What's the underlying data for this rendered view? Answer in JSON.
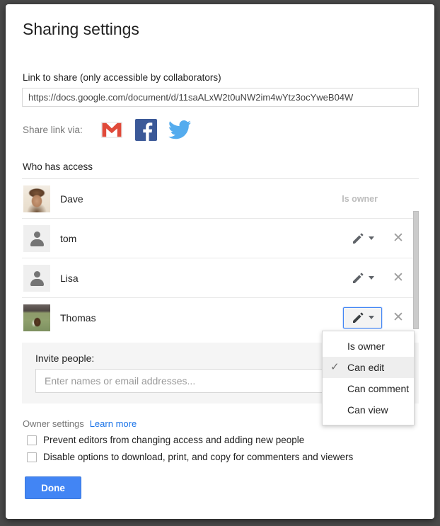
{
  "dialog": {
    "title": "Sharing settings"
  },
  "link_section": {
    "label": "Link to share (only accessible by collaborators)",
    "url": "https://docs.google.com/document/d/11saALxW2t0uNW2im4wYtz3ocYweB04W",
    "share_via_label": "Share link via:",
    "social": [
      {
        "name": "gmail-icon",
        "label": "Gmail",
        "color": "#d93025"
      },
      {
        "name": "facebook-icon",
        "label": "Facebook",
        "color": "#3b5998"
      },
      {
        "name": "twitter-icon",
        "label": "Twitter",
        "color": "#55acee"
      }
    ]
  },
  "access_section": {
    "heading": "Who has access",
    "rows": [
      {
        "name": "Dave",
        "avatar": "photo-person",
        "status": "Is owner",
        "has_controls": false
      },
      {
        "name": "tom",
        "avatar": "silhouette",
        "status": "",
        "has_controls": true
      },
      {
        "name": "Lisa",
        "avatar": "silhouette",
        "status": "",
        "has_controls": true
      },
      {
        "name": "Thomas",
        "avatar": "photo-dog",
        "status": "",
        "has_controls": true,
        "active": true
      }
    ]
  },
  "permission_menu": {
    "open": true,
    "items": [
      {
        "label": "Is owner",
        "checked": false
      },
      {
        "label": "Can edit",
        "checked": true
      },
      {
        "label": "Can comment",
        "checked": false
      },
      {
        "label": "Can view",
        "checked": false
      }
    ],
    "check_glyph": "✓"
  },
  "invite": {
    "label": "Invite people:",
    "placeholder": "Enter names or email addresses...",
    "value": ""
  },
  "owner_settings": {
    "label": "Owner settings",
    "learn_more": "Learn more",
    "checkboxes": [
      {
        "label": "Prevent editors from changing access and adding new people",
        "checked": false
      },
      {
        "label": "Disable options to download, print, and copy for commenters and viewers",
        "checked": false
      }
    ]
  },
  "footer": {
    "done_label": "Done"
  },
  "colors": {
    "accent": "#4285f4",
    "link": "#1a73e8",
    "panel_bg": "#f5f5f5",
    "muted_text": "#bdbdbd"
  }
}
